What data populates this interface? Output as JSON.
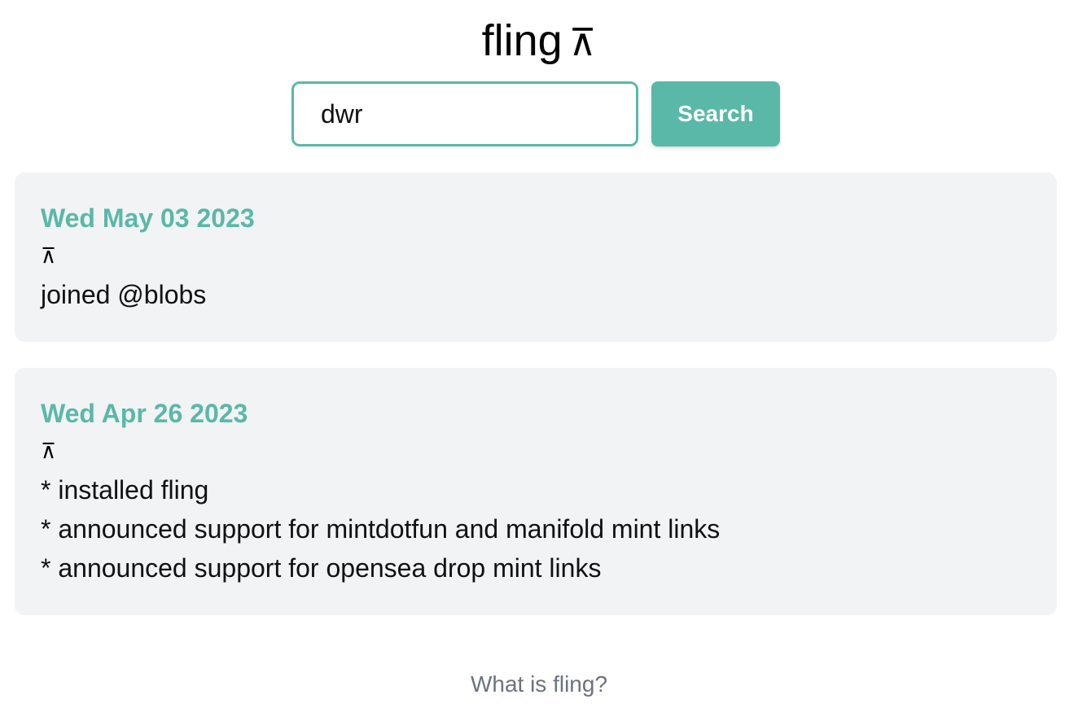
{
  "header": {
    "title": "fling",
    "logo_glyph": "⊼"
  },
  "search": {
    "value": "dwr",
    "placeholder": "",
    "button_label": "Search"
  },
  "entries": [
    {
      "date": "Wed May 03 2023",
      "glyph": "⊼",
      "lines": [
        "joined @blobs"
      ]
    },
    {
      "date": "Wed Apr 26 2023",
      "glyph": "⊼",
      "lines": [
        "* installed fling",
        "* announced support for mintdotfun and manifold mint links",
        "* announced support for opensea drop mint links"
      ]
    }
  ],
  "footer": {
    "link_label": "What is fling?"
  },
  "colors": {
    "accent": "#5ab8a8",
    "card_background": "#f2f3f5",
    "footer_text": "#6b7280"
  }
}
